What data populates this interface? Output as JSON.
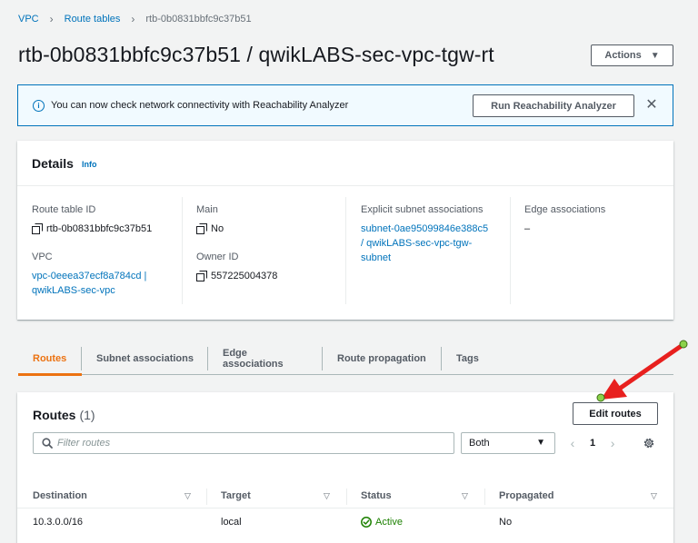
{
  "breadcrumb": {
    "items": [
      "VPC",
      "Route tables"
    ],
    "current": "rtb-0b0831bbfc9c37b51"
  },
  "header": {
    "title": "rtb-0b0831bbfc9c37b51 / qwikLABS-sec-vpc-tgw-rt",
    "actions_label": "Actions"
  },
  "flash": {
    "message": "You can now check network connectivity with Reachability Analyzer",
    "button_label": "Run Reachability Analyzer"
  },
  "details": {
    "title": "Details",
    "info_label": "Info",
    "route_table_id": {
      "label": "Route table ID",
      "value": "rtb-0b0831bbfc9c37b51"
    },
    "vpc": {
      "label": "VPC",
      "value_line1": "vpc-0eeea37ecf8a784cd |",
      "value_line2": "qwikLABS-sec-vpc"
    },
    "main": {
      "label": "Main",
      "value": "No"
    },
    "owner_id": {
      "label": "Owner ID",
      "value": "557225004378"
    },
    "explicit_subnet": {
      "label": "Explicit subnet associations",
      "line1": "subnet-0ae95099846e388c5",
      "line2": "/ qwikLABS-sec-vpc-tgw-",
      "line3": "subnet"
    },
    "edge": {
      "label": "Edge associations",
      "value": "–"
    }
  },
  "tabs": [
    {
      "label": "Routes",
      "active": true
    },
    {
      "label": "Subnet associations",
      "active": false
    },
    {
      "label": "Edge associations",
      "active": false
    },
    {
      "label": "Route propagation",
      "active": false
    },
    {
      "label": "Tags",
      "active": false
    }
  ],
  "routes": {
    "title": "Routes",
    "count": "(1)",
    "edit_label": "Edit routes",
    "filter_placeholder": "Filter routes",
    "select_value": "Both",
    "page": "1",
    "columns": [
      "Destination",
      "Target",
      "Status",
      "Propagated"
    ],
    "rows": [
      {
        "destination": "10.3.0.0/16",
        "target": "local",
        "status": "Active",
        "propagated": "No"
      }
    ]
  },
  "colors": {
    "accent": "#ec7211",
    "link": "#0073bb",
    "active_status": "#1d8102",
    "annotation_arrow": "#e8201e",
    "annotation_dot": "#8bd24a"
  },
  "icons": [
    "info-icon",
    "close-icon",
    "copy-icon",
    "search-icon",
    "caret-down-icon",
    "chevron-left-icon",
    "chevron-right-icon",
    "gear-icon",
    "sort-icon",
    "check-circle-icon"
  ]
}
